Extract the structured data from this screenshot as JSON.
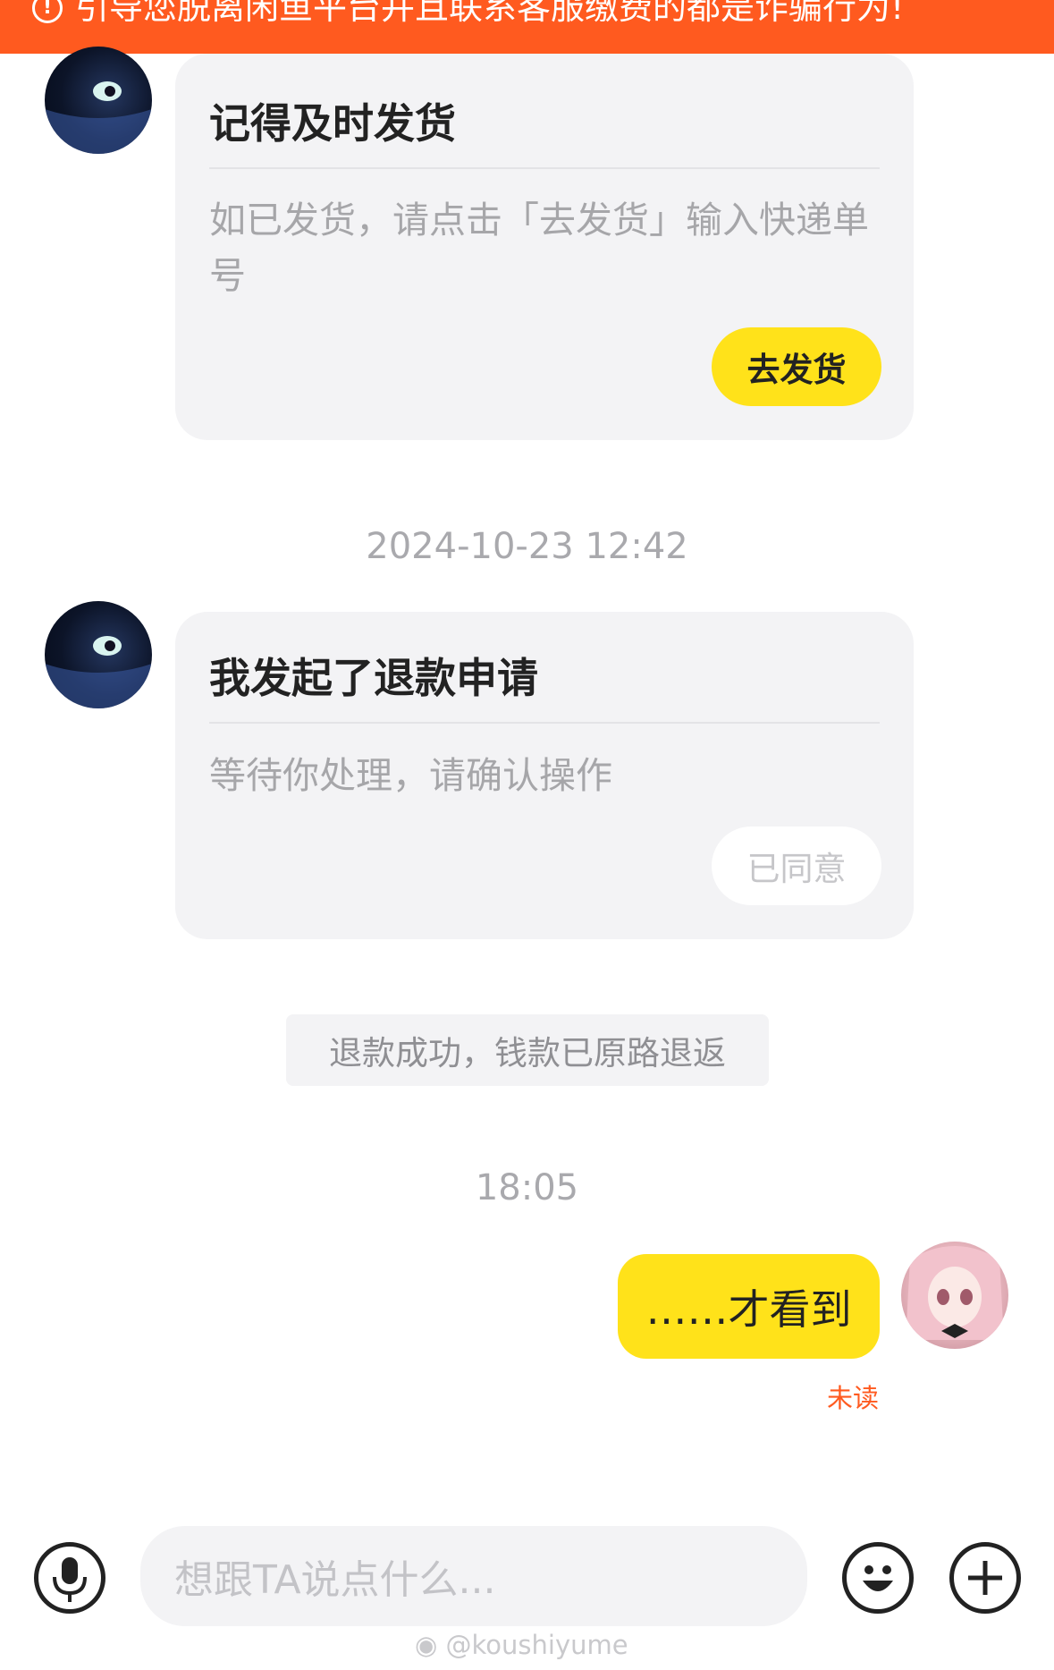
{
  "banner": {
    "icon": "exclamation-circle-icon",
    "text": "引导您脱离闲鱼平台并且联系客服缴费的都是诈骗行为!",
    "color": "#ff5a1f"
  },
  "messages": {
    "ship_card": {
      "title": "记得及时发货",
      "body": "如已发货，请点击「去发货」输入快递单号",
      "button": "去发货"
    },
    "timestamp_1": "2024-10-23 12:42",
    "refund_card": {
      "title": "我发起了退款申请",
      "body": "等待你处理，请确认操作",
      "button": "已同意"
    },
    "system_notice": "退款成功，钱款已原路退返",
    "timestamp_2": "18:05",
    "my_message": {
      "text": "……才看到",
      "status": "未读"
    }
  },
  "input_bar": {
    "placeholder": "想跟TA说点什么...",
    "voice_icon": "microphone-icon",
    "emoji_icon": "smiley-face-icon",
    "plus_icon": "plus-circle-icon"
  },
  "watermark": "@koushiyume",
  "colors": {
    "accent_yellow": "#ffe21a",
    "warning_orange": "#ff5a1f",
    "card_bg": "#f3f3f5"
  }
}
